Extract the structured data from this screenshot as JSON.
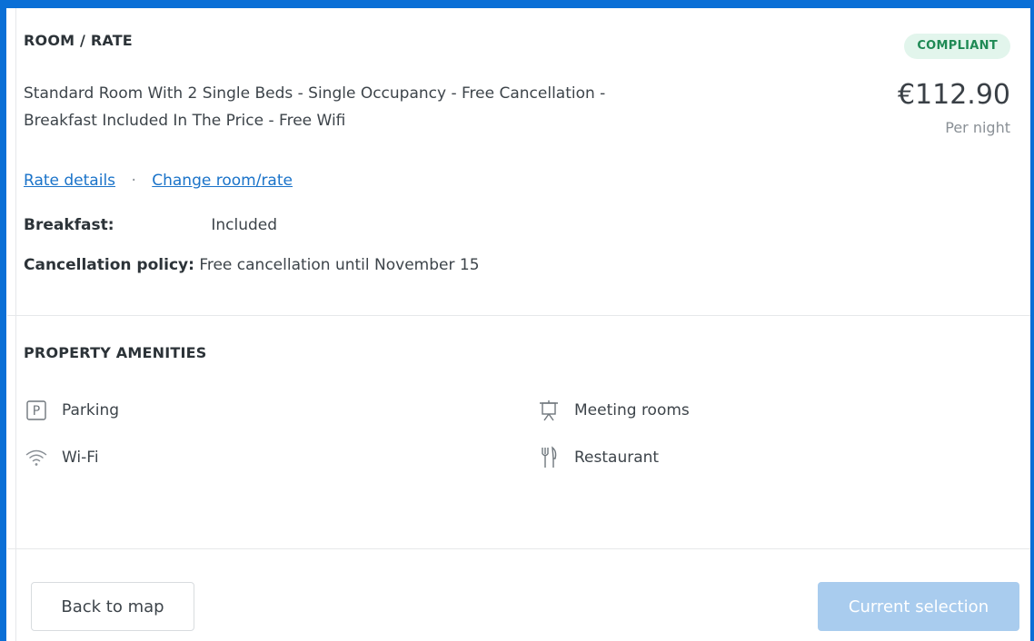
{
  "room_rate": {
    "section_title": "ROOM / RATE",
    "badge": "COMPLIANT",
    "description_line1": "Standard Room With 2 Single Beds - Single Occupancy - Free Cancellation -",
    "description_line2": "Breakfast Included In The Price - Free Wifi",
    "price": "€112.90",
    "price_unit": "Per night",
    "rate_details_link": "Rate details",
    "separator": "·",
    "change_room_link": "Change room/rate",
    "breakfast_label": "Breakfast:",
    "breakfast_value": "Included",
    "cancellation_label": "Cancellation policy:",
    "cancellation_value": "Free cancellation until November 15"
  },
  "amenities": {
    "section_title": "PROPERTY AMENITIES",
    "items": [
      {
        "label": "Parking",
        "icon": "parking-icon"
      },
      {
        "label": "Meeting rooms",
        "icon": "meeting-room-icon"
      },
      {
        "label": "Wi-Fi",
        "icon": "wifi-icon"
      },
      {
        "label": "Restaurant",
        "icon": "restaurant-icon"
      }
    ]
  },
  "footer": {
    "back_button": "Back to map",
    "current_button": "Current selection"
  },
  "colors": {
    "frame_border": "#0a6fd6",
    "link": "#1a73c9",
    "badge_bg": "#e2f5ec",
    "badge_text": "#1f8a55",
    "disabled_button": "#a9ccee"
  }
}
